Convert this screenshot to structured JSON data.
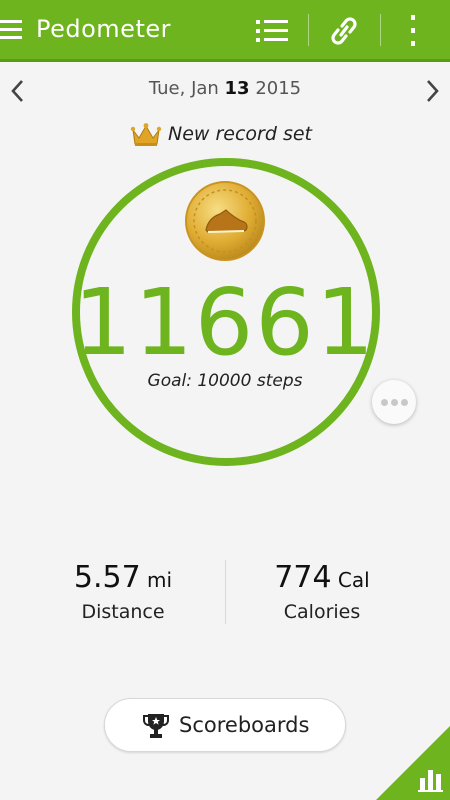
{
  "app": {
    "title": "Pedometer"
  },
  "colors": {
    "accent": "#6eb41e",
    "accent_dark": "#5a9a15",
    "background": "#f4f4f4",
    "gold": "#d9a521"
  },
  "icons": {
    "menu": "menu-icon",
    "list": "list-icon",
    "link": "link-icon",
    "more": "more-vertical-icon",
    "prev": "chevron-left-icon",
    "next": "chevron-right-icon",
    "crown": "crown-icon",
    "medal": "shoe-medal-icon",
    "dots": "more-horizontal-icon",
    "trophy": "trophy-icon",
    "chart": "bar-chart-icon"
  },
  "date": {
    "weekday_month": "Tue, Jan ",
    "day": "13",
    "year": " 2015"
  },
  "record": {
    "text": "New record set"
  },
  "steps": {
    "count": "11661",
    "goal_text": "Goal: 10000  steps"
  },
  "stats": {
    "distance": {
      "value": "5.57",
      "unit": " mi",
      "label": "Distance"
    },
    "calories": {
      "value": "774",
      "unit": " Cal",
      "label": "Calories"
    }
  },
  "scoreboards": {
    "label": "Scoreboards"
  }
}
